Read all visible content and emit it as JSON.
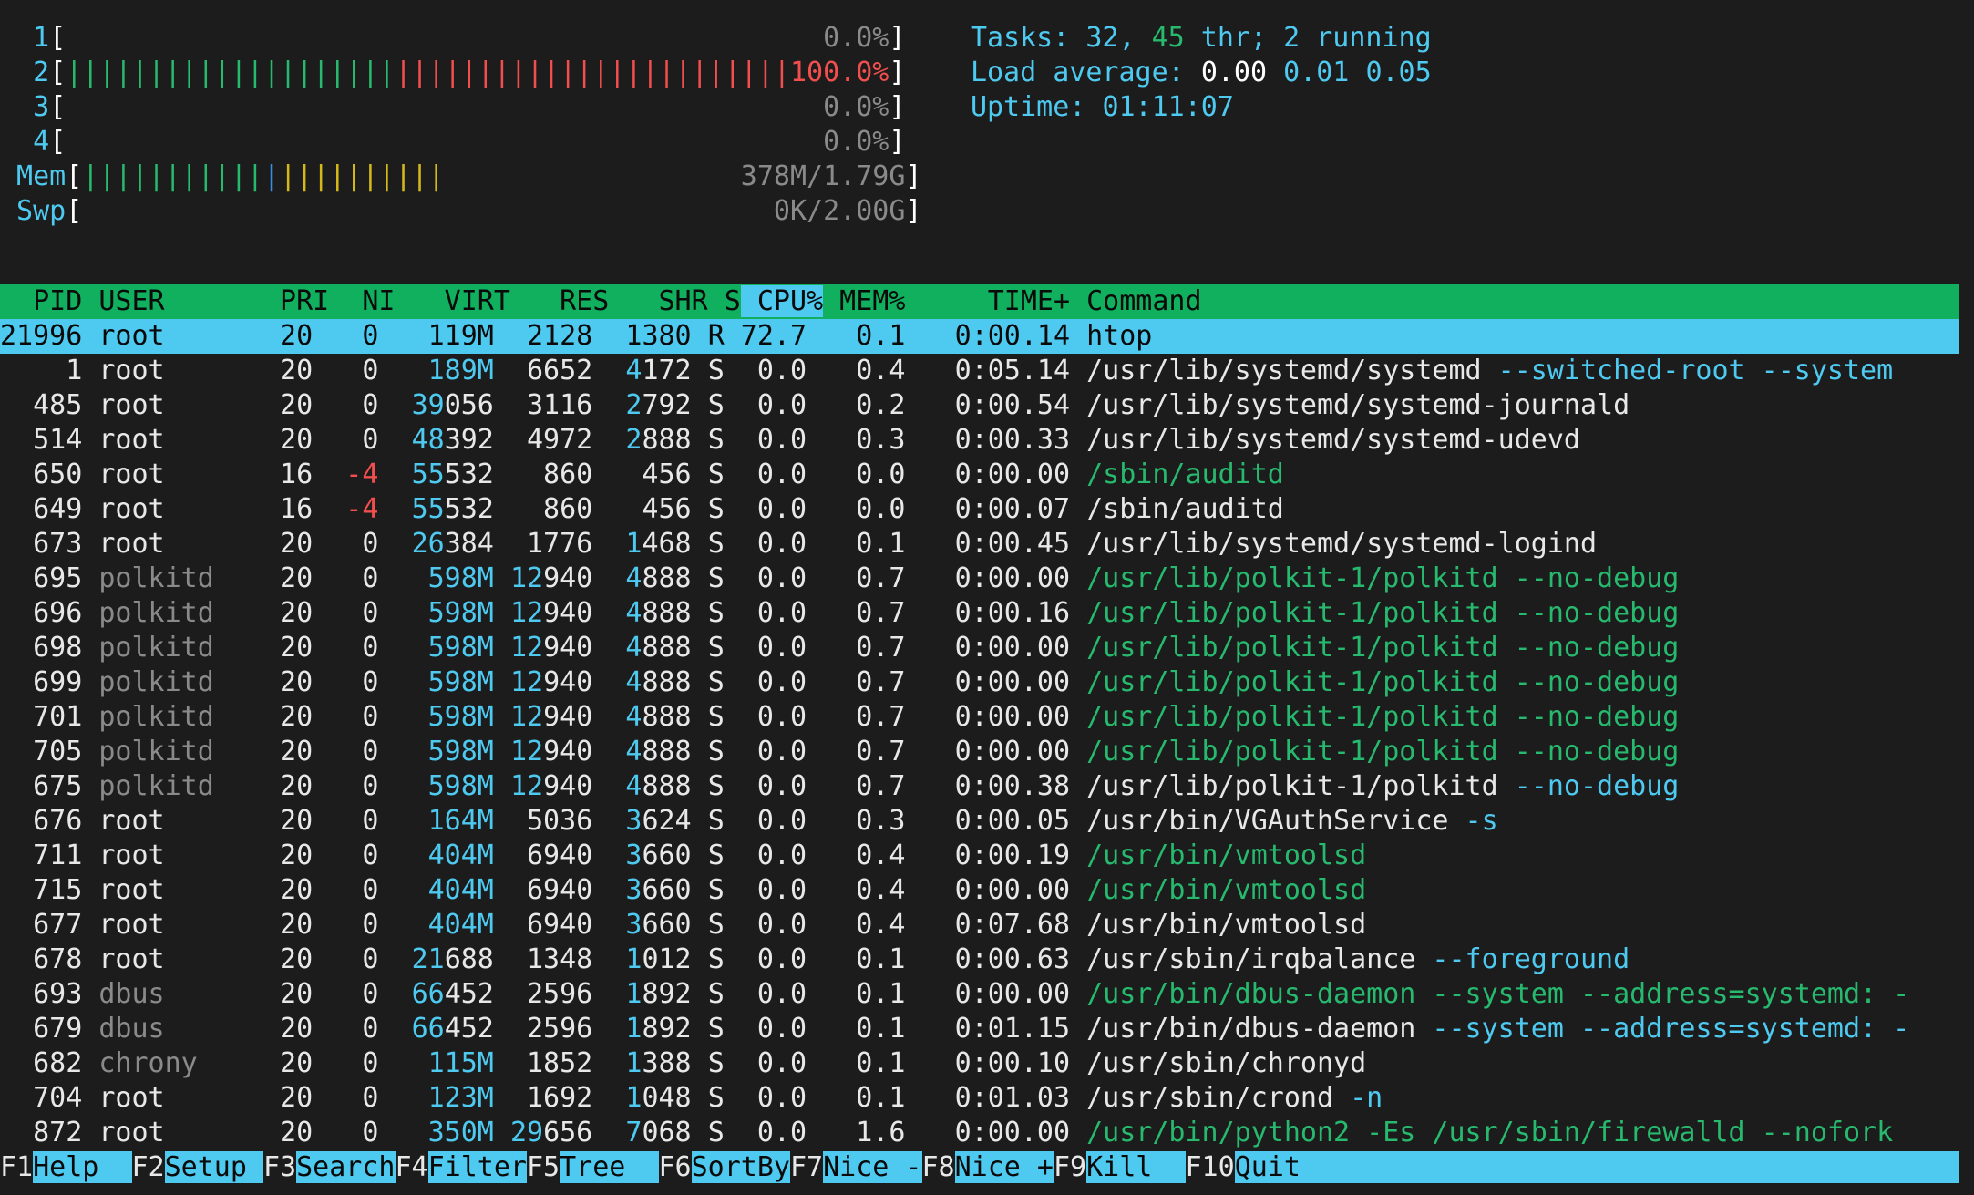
{
  "meters": {
    "cpus": [
      {
        "label": "1",
        "green": "",
        "red": "",
        "percent": "0.0%"
      },
      {
        "label": "2",
        "green": "||||||||||||||||||||",
        "red": "||||||||||||||||||||||||||||||",
        "percent": "100.0%"
      },
      {
        "label": "3",
        "green": "",
        "red": "",
        "percent": "0.0%"
      },
      {
        "label": "4",
        "green": "",
        "red": "",
        "percent": "0.0%"
      }
    ],
    "mem": {
      "label": "Mem",
      "green": "|||||||||||",
      "blue": "|",
      "yellow": "||||||||||",
      "value": "378M/1.79G"
    },
    "swp": {
      "label": "Swp",
      "value": "0K/2.00G"
    }
  },
  "summary": {
    "tasks_label": "Tasks: ",
    "tasks": "32",
    "thr": "45",
    "thr_label": " thr; ",
    "running": "2",
    "running_label": " running",
    "load_label": "Load average: ",
    "load1": "0.00",
    "load5": "0.01",
    "load15": "0.05",
    "uptime_label": "Uptime: ",
    "uptime": "01:11:07"
  },
  "columns": [
    "PID",
    "USER",
    "PRI",
    "NI",
    "VIRT",
    "RES",
    "SHR",
    "S",
    "CPU%",
    "MEM%",
    "TIME+",
    "Command"
  ],
  "sort_column": "CPU%",
  "processes": [
    {
      "pid": "21996",
      "user": "root",
      "pri": "20",
      "ni": "0",
      "virt": "119M",
      "res": "2128",
      "shr": "1380",
      "s": "R",
      "cpu": "72.7",
      "mem": "0.1",
      "time": "0:00.14",
      "cmd": "htop",
      "args": "",
      "thread": false,
      "selected": true
    },
    {
      "pid": "1",
      "user": "root",
      "pri": "20",
      "ni": "0",
      "virt": "189M",
      "res": "6652",
      "shr": "4172",
      "s": "S",
      "cpu": "0.0",
      "mem": "0.4",
      "time": "0:05.14",
      "cmd": "/usr/lib/systemd/systemd",
      "args": " --switched-root --system",
      "thread": false
    },
    {
      "pid": "485",
      "user": "root",
      "pri": "20",
      "ni": "0",
      "virt": "39056",
      "res": "3116",
      "shr": "2792",
      "s": "S",
      "cpu": "0.0",
      "mem": "0.2",
      "time": "0:00.54",
      "cmd": "/usr/lib/systemd/systemd-journald",
      "args": "",
      "thread": false
    },
    {
      "pid": "514",
      "user": "root",
      "pri": "20",
      "ni": "0",
      "virt": "48392",
      "res": "4972",
      "shr": "2888",
      "s": "S",
      "cpu": "0.0",
      "mem": "0.3",
      "time": "0:00.33",
      "cmd": "/usr/lib/systemd/systemd-udevd",
      "args": "",
      "thread": false
    },
    {
      "pid": "650",
      "user": "root",
      "pri": "16",
      "ni": "-4",
      "virt": "55532",
      "res": "860",
      "shr": "456",
      "s": "S",
      "cpu": "0.0",
      "mem": "0.0",
      "time": "0:00.00",
      "cmd": "/sbin/auditd",
      "args": "",
      "thread": true
    },
    {
      "pid": "649",
      "user": "root",
      "pri": "16",
      "ni": "-4",
      "virt": "55532",
      "res": "860",
      "shr": "456",
      "s": "S",
      "cpu": "0.0",
      "mem": "0.0",
      "time": "0:00.07",
      "cmd": "/sbin/auditd",
      "args": "",
      "thread": false
    },
    {
      "pid": "673",
      "user": "root",
      "pri": "20",
      "ni": "0",
      "virt": "26384",
      "res": "1776",
      "shr": "1468",
      "s": "S",
      "cpu": "0.0",
      "mem": "0.1",
      "time": "0:00.45",
      "cmd": "/usr/lib/systemd/systemd-logind",
      "args": "",
      "thread": false
    },
    {
      "pid": "695",
      "user": "polkitd",
      "pri": "20",
      "ni": "0",
      "virt": "598M",
      "res": "12940",
      "shr": "4888",
      "s": "S",
      "cpu": "0.0",
      "mem": "0.7",
      "time": "0:00.00",
      "cmd": "/usr/lib/polkit-1/polkitd",
      "args": " --no-debug",
      "thread": true
    },
    {
      "pid": "696",
      "user": "polkitd",
      "pri": "20",
      "ni": "0",
      "virt": "598M",
      "res": "12940",
      "shr": "4888",
      "s": "S",
      "cpu": "0.0",
      "mem": "0.7",
      "time": "0:00.16",
      "cmd": "/usr/lib/polkit-1/polkitd",
      "args": " --no-debug",
      "thread": true
    },
    {
      "pid": "698",
      "user": "polkitd",
      "pri": "20",
      "ni": "0",
      "virt": "598M",
      "res": "12940",
      "shr": "4888",
      "s": "S",
      "cpu": "0.0",
      "mem": "0.7",
      "time": "0:00.00",
      "cmd": "/usr/lib/polkit-1/polkitd",
      "args": " --no-debug",
      "thread": true
    },
    {
      "pid": "699",
      "user": "polkitd",
      "pri": "20",
      "ni": "0",
      "virt": "598M",
      "res": "12940",
      "shr": "4888",
      "s": "S",
      "cpu": "0.0",
      "mem": "0.7",
      "time": "0:00.00",
      "cmd": "/usr/lib/polkit-1/polkitd",
      "args": " --no-debug",
      "thread": true
    },
    {
      "pid": "701",
      "user": "polkitd",
      "pri": "20",
      "ni": "0",
      "virt": "598M",
      "res": "12940",
      "shr": "4888",
      "s": "S",
      "cpu": "0.0",
      "mem": "0.7",
      "time": "0:00.00",
      "cmd": "/usr/lib/polkit-1/polkitd",
      "args": " --no-debug",
      "thread": true
    },
    {
      "pid": "705",
      "user": "polkitd",
      "pri": "20",
      "ni": "0",
      "virt": "598M",
      "res": "12940",
      "shr": "4888",
      "s": "S",
      "cpu": "0.0",
      "mem": "0.7",
      "time": "0:00.00",
      "cmd": "/usr/lib/polkit-1/polkitd",
      "args": " --no-debug",
      "thread": true
    },
    {
      "pid": "675",
      "user": "polkitd",
      "pri": "20",
      "ni": "0",
      "virt": "598M",
      "res": "12940",
      "shr": "4888",
      "s": "S",
      "cpu": "0.0",
      "mem": "0.7",
      "time": "0:00.38",
      "cmd": "/usr/lib/polkit-1/polkitd",
      "args": " --no-debug",
      "thread": false
    },
    {
      "pid": "676",
      "user": "root",
      "pri": "20",
      "ni": "0",
      "virt": "164M",
      "res": "5036",
      "shr": "3624",
      "s": "S",
      "cpu": "0.0",
      "mem": "0.3",
      "time": "0:00.05",
      "cmd": "/usr/bin/VGAuthService",
      "args": " -s",
      "thread": false
    },
    {
      "pid": "711",
      "user": "root",
      "pri": "20",
      "ni": "0",
      "virt": "404M",
      "res": "6940",
      "shr": "3660",
      "s": "S",
      "cpu": "0.0",
      "mem": "0.4",
      "time": "0:00.19",
      "cmd": "/usr/bin/vmtoolsd",
      "args": "",
      "thread": true
    },
    {
      "pid": "715",
      "user": "root",
      "pri": "20",
      "ni": "0",
      "virt": "404M",
      "res": "6940",
      "shr": "3660",
      "s": "S",
      "cpu": "0.0",
      "mem": "0.4",
      "time": "0:00.00",
      "cmd": "/usr/bin/vmtoolsd",
      "args": "",
      "thread": true
    },
    {
      "pid": "677",
      "user": "root",
      "pri": "20",
      "ni": "0",
      "virt": "404M",
      "res": "6940",
      "shr": "3660",
      "s": "S",
      "cpu": "0.0",
      "mem": "0.4",
      "time": "0:07.68",
      "cmd": "/usr/bin/vmtoolsd",
      "args": "",
      "thread": false
    },
    {
      "pid": "678",
      "user": "root",
      "pri": "20",
      "ni": "0",
      "virt": "21688",
      "res": "1348",
      "shr": "1012",
      "s": "S",
      "cpu": "0.0",
      "mem": "0.1",
      "time": "0:00.63",
      "cmd": "/usr/sbin/irqbalance",
      "args": " --foreground",
      "thread": false
    },
    {
      "pid": "693",
      "user": "dbus",
      "pri": "20",
      "ni": "0",
      "virt": "66452",
      "res": "2596",
      "shr": "1892",
      "s": "S",
      "cpu": "0.0",
      "mem": "0.1",
      "time": "0:00.00",
      "cmd": "/usr/bin/dbus-daemon",
      "args": " --system --address=systemd: -",
      "thread": true
    },
    {
      "pid": "679",
      "user": "dbus",
      "pri": "20",
      "ni": "0",
      "virt": "66452",
      "res": "2596",
      "shr": "1892",
      "s": "S",
      "cpu": "0.0",
      "mem": "0.1",
      "time": "0:01.15",
      "cmd": "/usr/bin/dbus-daemon",
      "args": " --system --address=systemd: -",
      "thread": false
    },
    {
      "pid": "682",
      "user": "chrony",
      "pri": "20",
      "ni": "0",
      "virt": "115M",
      "res": "1852",
      "shr": "1388",
      "s": "S",
      "cpu": "0.0",
      "mem": "0.1",
      "time": "0:00.10",
      "cmd": "/usr/sbin/chronyd",
      "args": "",
      "thread": false
    },
    {
      "pid": "704",
      "user": "root",
      "pri": "20",
      "ni": "0",
      "virt": "123M",
      "res": "1692",
      "shr": "1048",
      "s": "S",
      "cpu": "0.0",
      "mem": "0.1",
      "time": "0:01.03",
      "cmd": "/usr/sbin/crond",
      "args": " -n",
      "thread": false
    },
    {
      "pid": "872",
      "user": "root",
      "pri": "20",
      "ni": "0",
      "virt": "350M",
      "res": "29656",
      "shr": "7068",
      "s": "S",
      "cpu": "0.0",
      "mem": "1.6",
      "time": "0:00.00",
      "cmd": "/usr/bin/python2 -Es /usr/sbin/firewalld --nofork",
      "args": "",
      "thread": true
    }
  ],
  "function_keys": [
    {
      "key": "F1",
      "label": "Help  "
    },
    {
      "key": "F2",
      "label": "Setup "
    },
    {
      "key": "F3",
      "label": "Search"
    },
    {
      "key": "F4",
      "label": "Filter"
    },
    {
      "key": "F5",
      "label": "Tree  "
    },
    {
      "key": "F6",
      "label": "SortBy"
    },
    {
      "key": "F7",
      "label": "Nice -"
    },
    {
      "key": "F8",
      "label": "Nice +"
    },
    {
      "key": "F9",
      "label": "Kill  "
    },
    {
      "key": "F10",
      "label": "Quit"
    }
  ],
  "colors": {
    "background": "#1c1c1c",
    "accent_cyan": "#4ec9f0",
    "header_green": "#10b05e",
    "bar_green": "#27b96e",
    "bar_red": "#f24e4e",
    "bar_yellow": "#d4b91a"
  }
}
